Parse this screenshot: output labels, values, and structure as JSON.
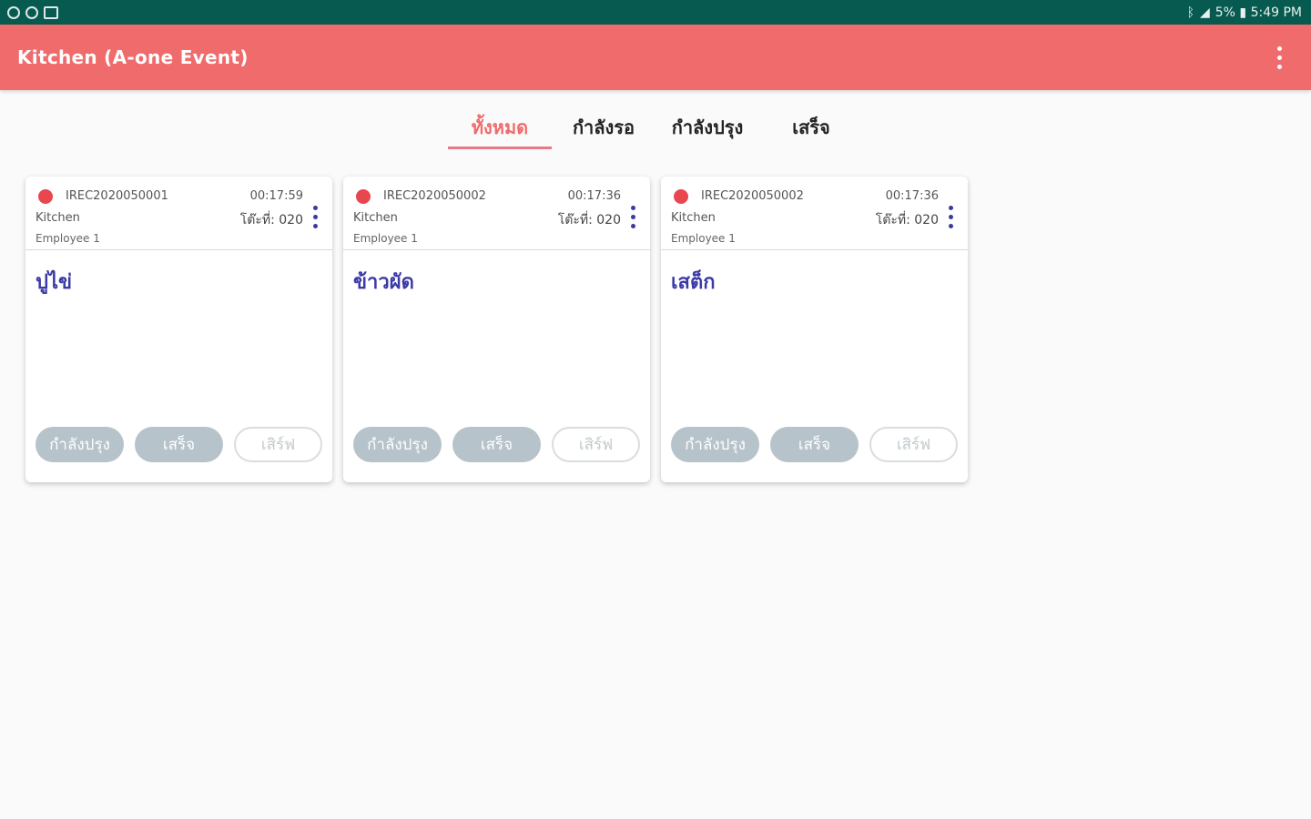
{
  "status_bar": {
    "left_icons": [
      "sync-icon",
      "sync-icon",
      "image-icon"
    ],
    "right_text": "5% ▮ 5:49 PM"
  },
  "app_bar": {
    "title": "Kitchen  (A-one Event)",
    "menu_icon": "more-vert-icon"
  },
  "tabs": [
    {
      "label": "ทั้งหมด",
      "active": true
    },
    {
      "label": "กำลังรอ",
      "active": false
    },
    {
      "label": "กำลังปรุง",
      "active": false
    },
    {
      "label": "เสร็จ",
      "active": false
    }
  ],
  "orders": [
    {
      "code": "IREC2020050001",
      "time": "00:17:59",
      "department": "Kitchen",
      "table": "โต๊ะที่: 020",
      "employee": "Employee 1",
      "menu": "ปูไข่",
      "buttons": {
        "cooking": "กำลังปรุง",
        "done": "เสร็จ",
        "serve": "เสิร์ฟ"
      }
    },
    {
      "code": "IREC2020050002",
      "time": "00:17:36",
      "department": "Kitchen",
      "table": "โต๊ะที่: 020",
      "employee": "Employee 1",
      "menu": "ข้าวผัด",
      "buttons": {
        "cooking": "กำลังปรุง",
        "done": "เสร็จ",
        "serve": "เสิร์ฟ"
      }
    },
    {
      "code": "IREC2020050002",
      "time": "00:17:36",
      "department": "Kitchen",
      "table": "โต๊ะที่: 020",
      "employee": "Employee 1",
      "menu": "เสต็ก",
      "buttons": {
        "cooking": "กำลังปรุง",
        "done": "เสร็จ",
        "serve": "เสิร์ฟ"
      }
    }
  ],
  "colors": {
    "status_bar": "#075a4f",
    "app_bar": "#f06b6b",
    "active_tab": "#f06b6b",
    "status_dot": "#e8474f",
    "menu_text": "#3c3aa6",
    "button_filled": "#b7c3ca"
  }
}
